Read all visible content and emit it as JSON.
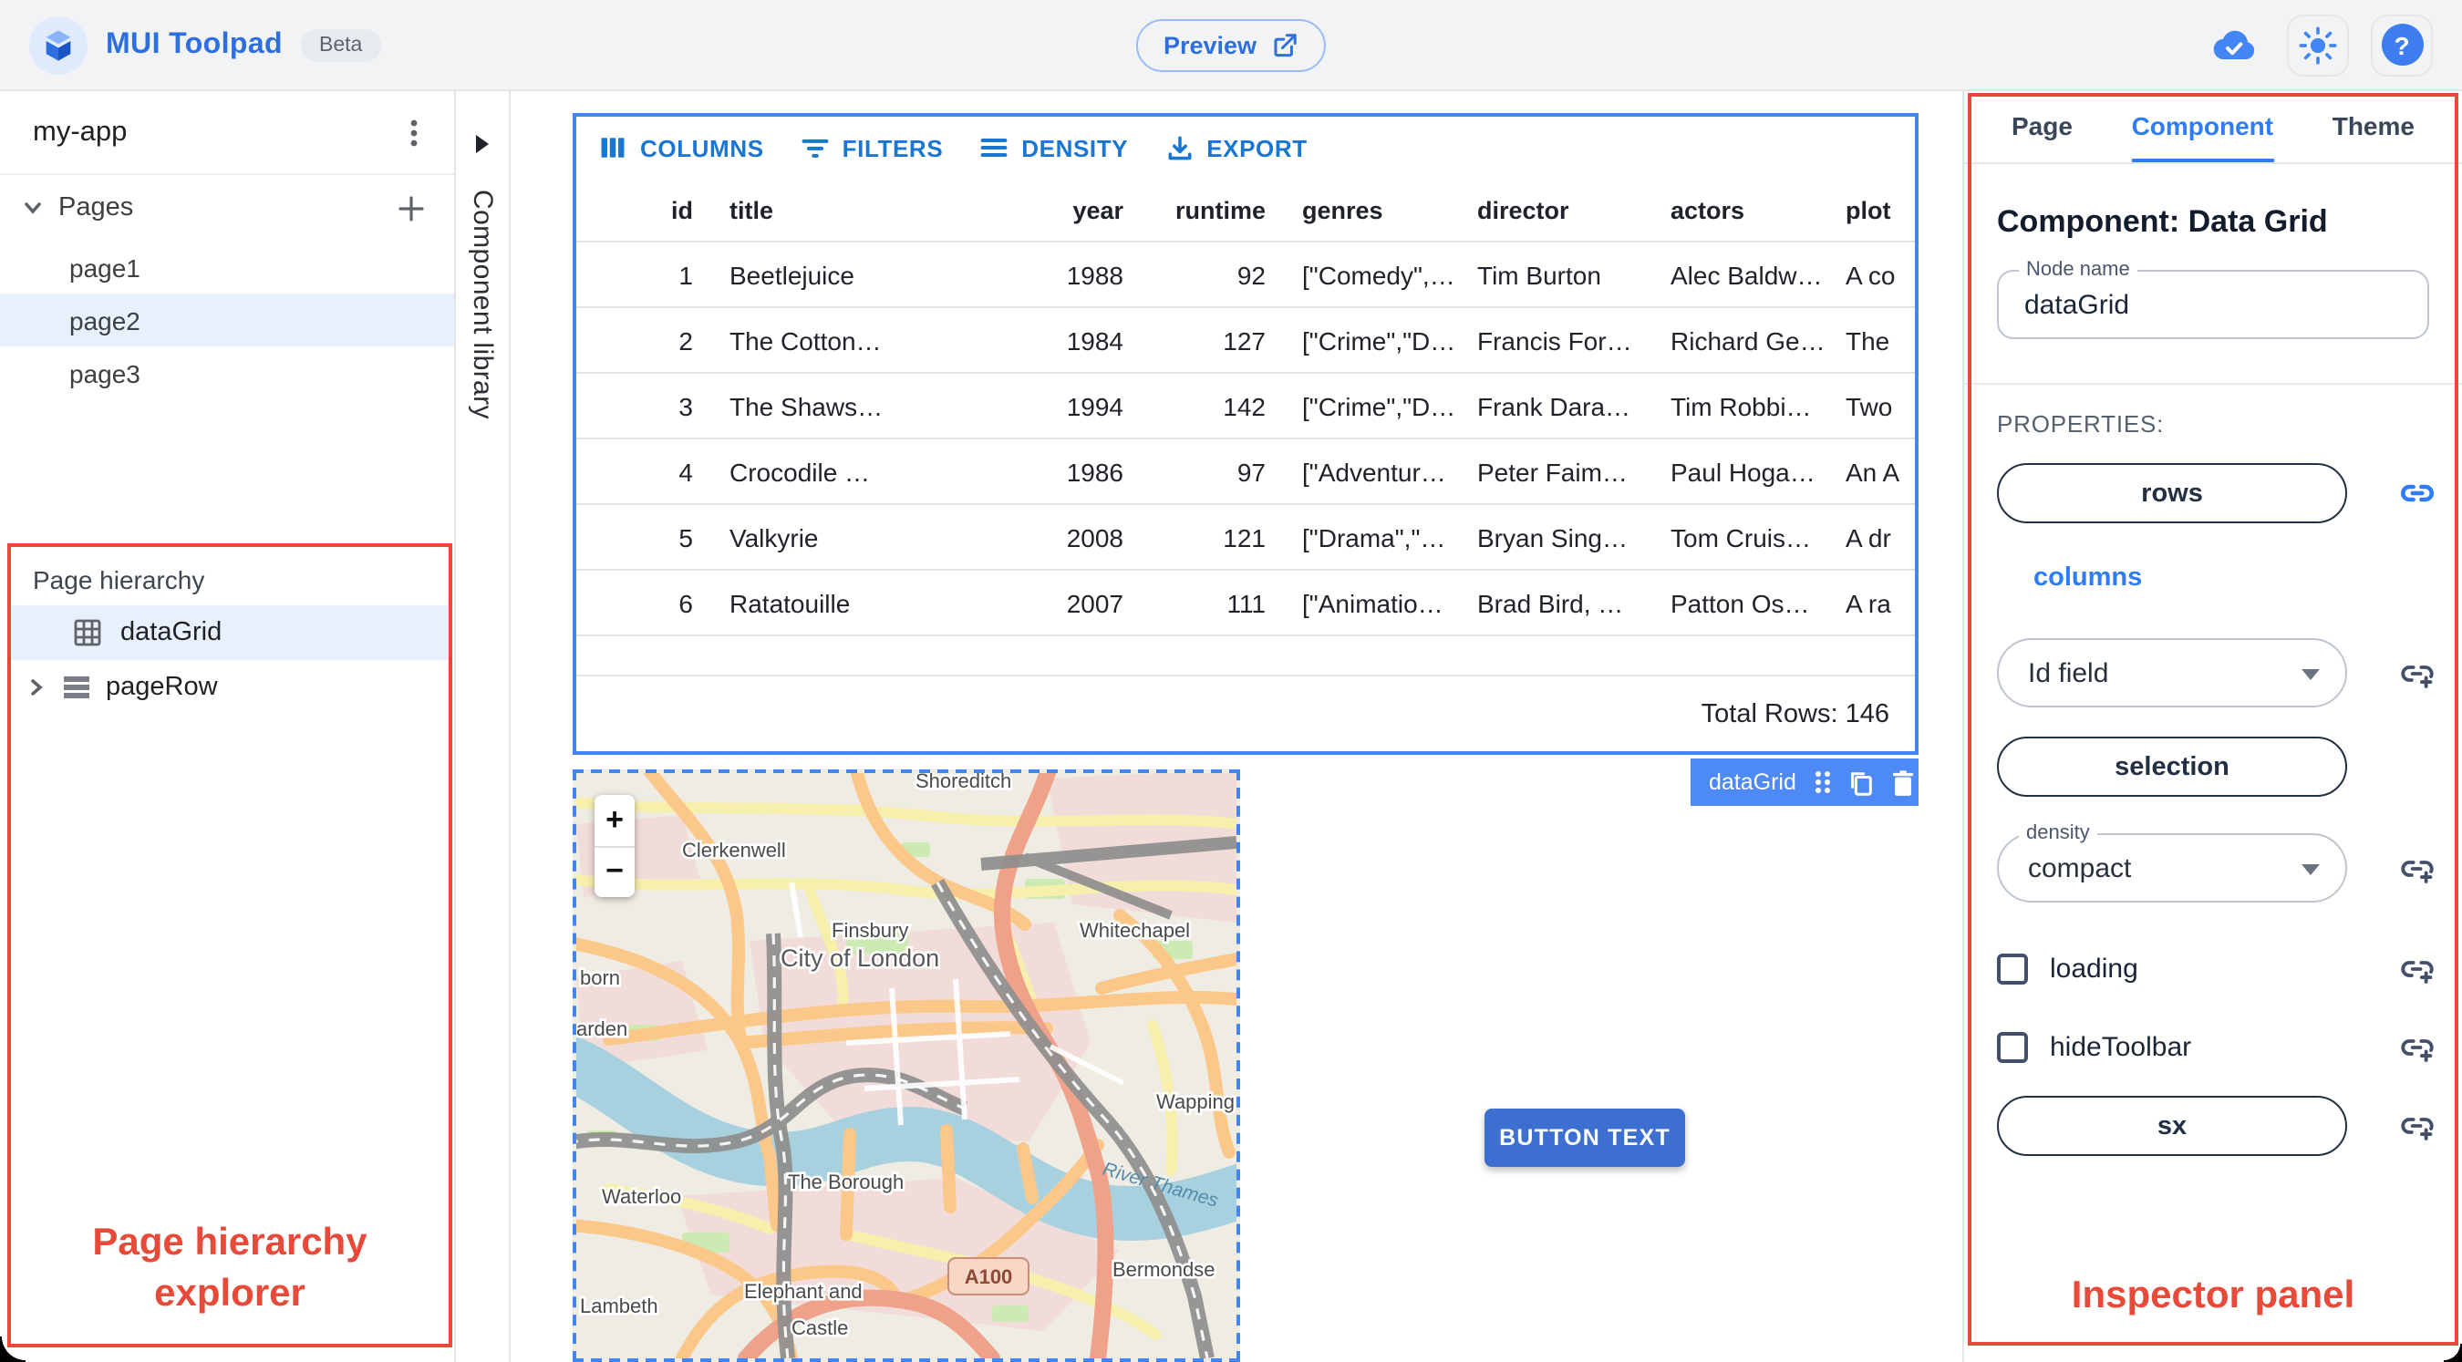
{
  "header": {
    "app_title": "MUI Toolpad",
    "beta_badge": "Beta",
    "preview_button": "Preview"
  },
  "sidebar": {
    "project_name": "my-app",
    "pages_label": "Pages",
    "pages": [
      "page1",
      "page2",
      "page3"
    ],
    "selected_page": "page2"
  },
  "hierarchy": {
    "panel_label": "Page hierarchy",
    "items": [
      {
        "label": "dataGrid",
        "selected": true
      },
      {
        "label": "pageRow",
        "selected": false
      }
    ],
    "annotation": "Page hierarchy explorer"
  },
  "component_library": {
    "label": "Component library"
  },
  "grid": {
    "toolbar": [
      "COLUMNS",
      "FILTERS",
      "DENSITY",
      "EXPORT"
    ],
    "columns": [
      "id",
      "title",
      "year",
      "runtime",
      "genres",
      "director",
      "actors",
      "plot"
    ],
    "rows": [
      {
        "id": "1",
        "title": "Beetlejuice",
        "year": "1988",
        "runtime": "92",
        "genres": "[\"Comedy\",…",
        "director": "Tim Burton",
        "actors": "Alec Baldw…",
        "plot": "A co"
      },
      {
        "id": "2",
        "title": "The Cotton…",
        "year": "1984",
        "runtime": "127",
        "genres": "[\"Crime\",\"D…",
        "director": "Francis For…",
        "actors": "Richard Ge…",
        "plot": "The"
      },
      {
        "id": "3",
        "title": "The Shaws…",
        "year": "1994",
        "runtime": "142",
        "genres": "[\"Crime\",\"D…",
        "director": "Frank Dara…",
        "actors": "Tim Robbi…",
        "plot": "Two"
      },
      {
        "id": "4",
        "title": "Crocodile …",
        "year": "1986",
        "runtime": "97",
        "genres": "[\"Adventur…",
        "director": "Peter Faim…",
        "actors": "Paul Hoga…",
        "plot": "An A"
      },
      {
        "id": "5",
        "title": "Valkyrie",
        "year": "2008",
        "runtime": "121",
        "genres": "[\"Drama\",\"…",
        "director": "Bryan Sing…",
        "actors": "Tom Cruis…",
        "plot": "A dr"
      },
      {
        "id": "6",
        "title": "Ratatouille",
        "year": "2007",
        "runtime": "111",
        "genres": "[\"Animatio…",
        "director": "Brad Bird, …",
        "actors": "Patton Os…",
        "plot": "A ra"
      }
    ],
    "footer": "Total Rows: 146",
    "selection_tag": "dataGrid"
  },
  "map": {
    "zoom_in": "+",
    "zoom_out": "−",
    "labels": {
      "shoreditch": "Shoreditch",
      "clerkenwell": "Clerkenwell",
      "finsbury": "Finsbury",
      "holborn_clipped": "born",
      "whitechapel": "Whitechapel",
      "city_of_london": "City of London",
      "garden_clipped": "arden",
      "waterloo": "Waterloo",
      "the_borough": "The Borough",
      "wapping": "Wapping",
      "lambeth": "Lambeth",
      "elephant_line1": "Elephant and",
      "elephant_line2": "Castle",
      "bermondsey": "Bermondse",
      "river": "River Thames",
      "road_badge": "A100"
    }
  },
  "canvas": {
    "button_label": "BUTTON TEXT"
  },
  "inspector": {
    "tabs": [
      "Page",
      "Component",
      "Theme"
    ],
    "active_tab": "Component",
    "heading": "Component: Data Grid",
    "node_name_label": "Node name",
    "node_name_value": "dataGrid",
    "properties_label": "PROPERTIES:",
    "rows_button": "rows",
    "columns_link": "columns",
    "id_field_label": "Id field",
    "selection_button": "selection",
    "density_label": "density",
    "density_value": "compact",
    "loading_label": "loading",
    "hide_toolbar_label": "hideToolbar",
    "sx_button": "sx",
    "annotation": "Inspector panel"
  },
  "colors": {
    "accent_blue": "#2e7cf6",
    "mui_blue": "#1976d2",
    "selection_blue": "#4286f5",
    "annotation_red": "#e74a38",
    "selected_row_bg": "#e8f0fe"
  }
}
